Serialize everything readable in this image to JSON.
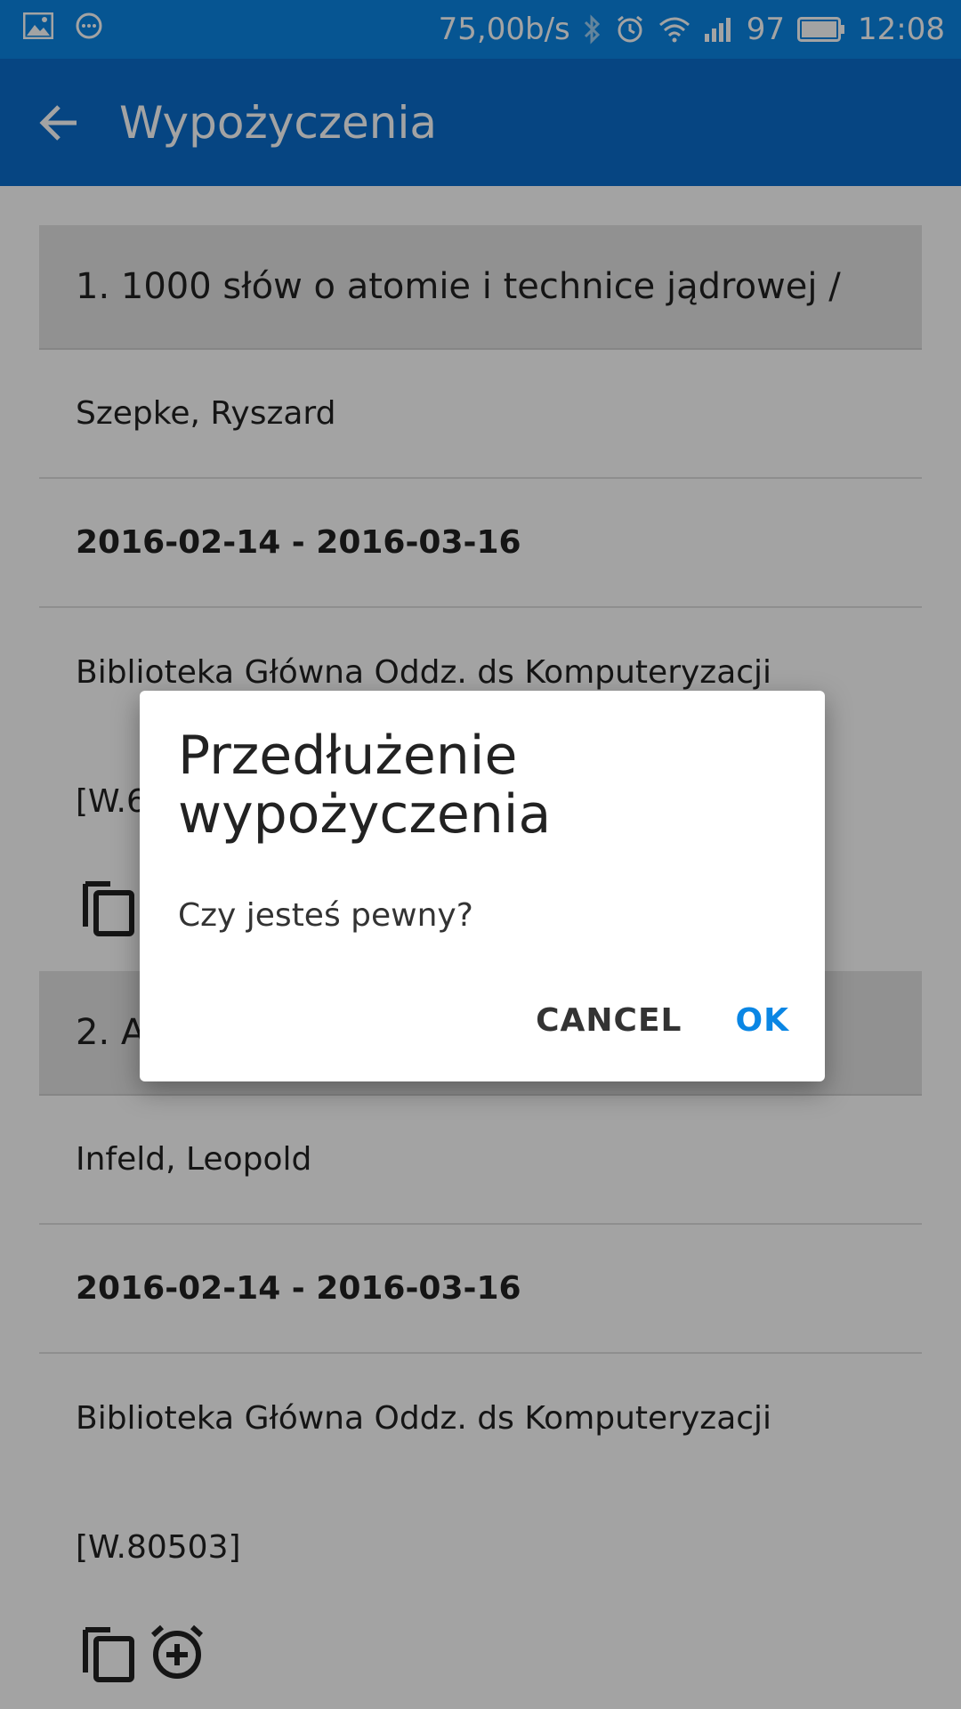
{
  "status_bar": {
    "network_speed": "75,00b/s",
    "battery_level": "97",
    "time": "12:08",
    "icons": [
      "image-icon",
      "chat-icon",
      "bluetooth-icon",
      "alarm-icon",
      "wifi-icon",
      "signal-icon",
      "battery-icon"
    ]
  },
  "app_bar": {
    "title": "Wypożyczenia",
    "back_icon": "arrow-left-icon"
  },
  "loans": [
    {
      "title": "1. 1000 słów o atomie i technice jądrowej /",
      "author": "Szepke, Ryszard",
      "dates": "2016-02-14 - 2016-03-16",
      "library": "Biblioteka Główna Oddz. ds Komputeryzacji",
      "signature": "[W.6",
      "actions": [
        "copy-icon"
      ]
    },
    {
      "title": "2. A",
      "author": "Infeld, Leopold",
      "dates": "2016-02-14 - 2016-03-16",
      "library": "Biblioteka Główna Oddz. ds Komputeryzacji",
      "signature": "[W.80503]",
      "actions": [
        "copy-icon",
        "alarm-add-icon"
      ]
    }
  ],
  "dialog": {
    "title_line1": "Przedłużenie",
    "title_line2": "wypożyczenia",
    "message": "Czy jesteś pewny?",
    "cancel_label": "CANCEL",
    "ok_label": "OK"
  },
  "colors": {
    "status_bar": "#0a86e4",
    "app_bar": "#0a6ccc",
    "accent": "#0a86e4"
  }
}
